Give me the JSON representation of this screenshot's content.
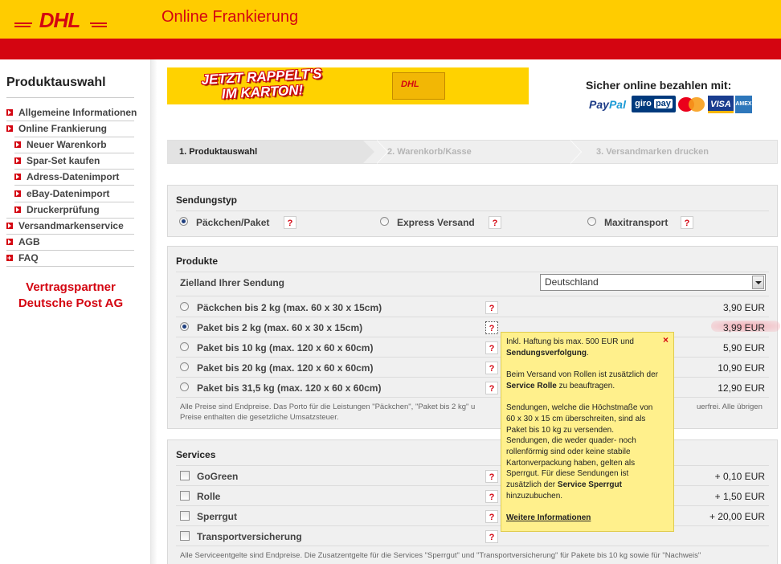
{
  "header": {
    "logo_text": "DHL",
    "title": "Online Frankierung"
  },
  "colors": {
    "yellow": "#ffcc00",
    "red": "#d40511"
  },
  "sidebar": {
    "title": "Produktauswahl",
    "items": [
      {
        "label": "Allgemeine Informationen",
        "icon": "arrow-bullet-icon"
      },
      {
        "label": "Online Frankierung",
        "icon": "arrow-bullet-icon"
      },
      {
        "label": "Neuer Warenkorb",
        "icon": "arrow-bullet-icon"
      },
      {
        "label": "Spar-Set kaufen",
        "icon": "arrow-bullet-icon"
      },
      {
        "label": "Adress-Datenimport",
        "icon": "arrow-bullet-icon"
      },
      {
        "label": "eBay-Datenimport",
        "icon": "arrow-bullet-icon"
      },
      {
        "label": "Druckerprüfung",
        "icon": "arrow-bullet-icon"
      },
      {
        "label": "Versandmarkenservice",
        "icon": "arrow-bullet-icon"
      },
      {
        "label": "AGB",
        "icon": "arrow-bullet-icon"
      },
      {
        "label": "FAQ",
        "icon": "plus-bullet-icon"
      }
    ],
    "partner_line1": "Vertragspartner",
    "partner_line2": "Deutsche Post AG"
  },
  "banner": {
    "line1": "JETZT RAPPELT'S",
    "line2": "IM KARTON!",
    "box_logo": "DHL"
  },
  "payment": {
    "title": "Sicher online bezahlen mit:",
    "paypal_pay": "Pay",
    "paypal_pal": "Pal",
    "giro": "giro",
    "giro_pay": "pay",
    "visa": "VISA",
    "amex": "AMEX"
  },
  "steps": [
    {
      "label": "1. Produktauswahl",
      "active": true
    },
    {
      "label": "2. Warenkorb/Kasse",
      "active": false
    },
    {
      "label": "3. Versandmarken drucken",
      "active": false
    }
  ],
  "sendungstyp": {
    "title": "Sendungstyp",
    "options": [
      {
        "label": "Päckchen/Paket",
        "selected": true
      },
      {
        "label": "Express Versand",
        "selected": false
      },
      {
        "label": "Maxitransport",
        "selected": false
      }
    ],
    "help": "?"
  },
  "produkte": {
    "title": "Produkte",
    "zielland_label": "Zielland Ihrer Sendung",
    "zielland_value": "Deutschland",
    "items": [
      {
        "label": "Päckchen bis 2 kg (max. 60 x 30 x 15cm)",
        "price": "3,90 EUR",
        "selected": false
      },
      {
        "label": "Paket bis 2 kg (max. 60 x 30 x 15cm)",
        "price": "3,99 EUR",
        "selected": true
      },
      {
        "label": "Paket bis 10 kg (max. 120 x 60 x 60cm)",
        "price": "5,90 EUR",
        "selected": false
      },
      {
        "label": "Paket bis 20 kg (max. 120 x 60 x 60cm)",
        "price": "10,90 EUR",
        "selected": false
      },
      {
        "label": "Paket bis 31,5 kg (max. 120 x 60 x 60cm)",
        "price": "12,90 EUR",
        "selected": false
      }
    ],
    "note_a": "Alle Preise sind Endpreise. Das Porto für die Leistungen \"Päckchen\", \"Paket bis 2 kg\" u",
    "note_b": "uerfrei. Alle übrigen",
    "note_c": "Preise enthalten die gesetzliche Umsatzsteuer."
  },
  "services": {
    "title": "Services",
    "items": [
      {
        "label": "GoGreen",
        "price": "+ 0,10 EUR"
      },
      {
        "label": "Rolle",
        "price": "+ 1,50 EUR"
      },
      {
        "label": "Sperrgut",
        "price": "+ 20,00 EUR"
      },
      {
        "label": "Transportversicherung",
        "price": ""
      }
    ],
    "note": "Alle Serviceentgelte sind Endpreise. Die Zusatzentgelte für die Services \"Sperrgut\" und \"Transportversicherung\" für Pakete bis 10 kg sowie für \"Nachweis\""
  },
  "tooltip": {
    "close": "×",
    "p1_text": "Inkl. Haftung bis max. 500 EUR und",
    "p1_bold": "Sendungsverfolgung",
    "p1_end": ".",
    "p2_text": "Beim Versand von Rollen ist zusätzlich der",
    "p2_bold": "Service Rolle",
    "p2_end": "zu beauftragen.",
    "p3_text": "Sendungen, welche die Höchstmaße von 60 x 30 x 15 cm überschreiten, sind als Paket bis 10 kg zu versenden. Sendungen, die weder quader- noch rollenförmig sind oder keine stabile Kartonverpackung haben, gelten als Sperrgut. Für diese Sendungen ist zusätzlich der",
    "p3_bold": "Service Sperrgut",
    "p3_end": "hinzuzubuchen.",
    "link": "Weitere Informationen"
  }
}
